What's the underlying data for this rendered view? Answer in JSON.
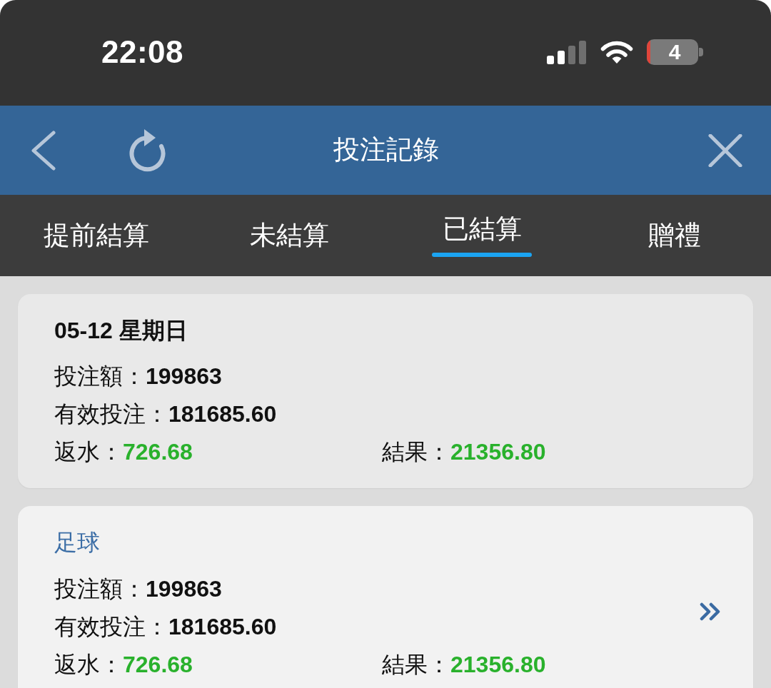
{
  "status_bar": {
    "time": "22:08",
    "battery_percent": "4"
  },
  "header": {
    "title": "投注記錄"
  },
  "tabs": [
    {
      "label": "提前結算",
      "selected": false
    },
    {
      "label": "未結算",
      "selected": false
    },
    {
      "label": "已結算",
      "selected": true
    },
    {
      "label": "贈禮",
      "selected": false
    }
  ],
  "cards": [
    {
      "kind": "day",
      "title": "05-12 星期日",
      "lines": [
        [
          {
            "label": "投注額：",
            "value": "199863",
            "kind": "plain"
          }
        ],
        [
          {
            "label": "有效投注：",
            "value": "181685.60",
            "kind": "plain"
          }
        ],
        [
          {
            "label": "返水：",
            "value": "726.68",
            "kind": "positive"
          },
          {
            "label": "結果：",
            "value": "21356.80",
            "kind": "positive"
          }
        ]
      ]
    },
    {
      "kind": "sport",
      "title": "足球",
      "lines": [
        [
          {
            "label": "投注額：",
            "value": "199863",
            "kind": "plain"
          }
        ],
        [
          {
            "label": "有效投注：",
            "value": "181685.60",
            "kind": "plain"
          }
        ],
        [
          {
            "label": "返水：",
            "value": "726.68",
            "kind": "positive"
          },
          {
            "label": "結果：",
            "value": "21356.80",
            "kind": "positive"
          }
        ]
      ]
    }
  ]
}
